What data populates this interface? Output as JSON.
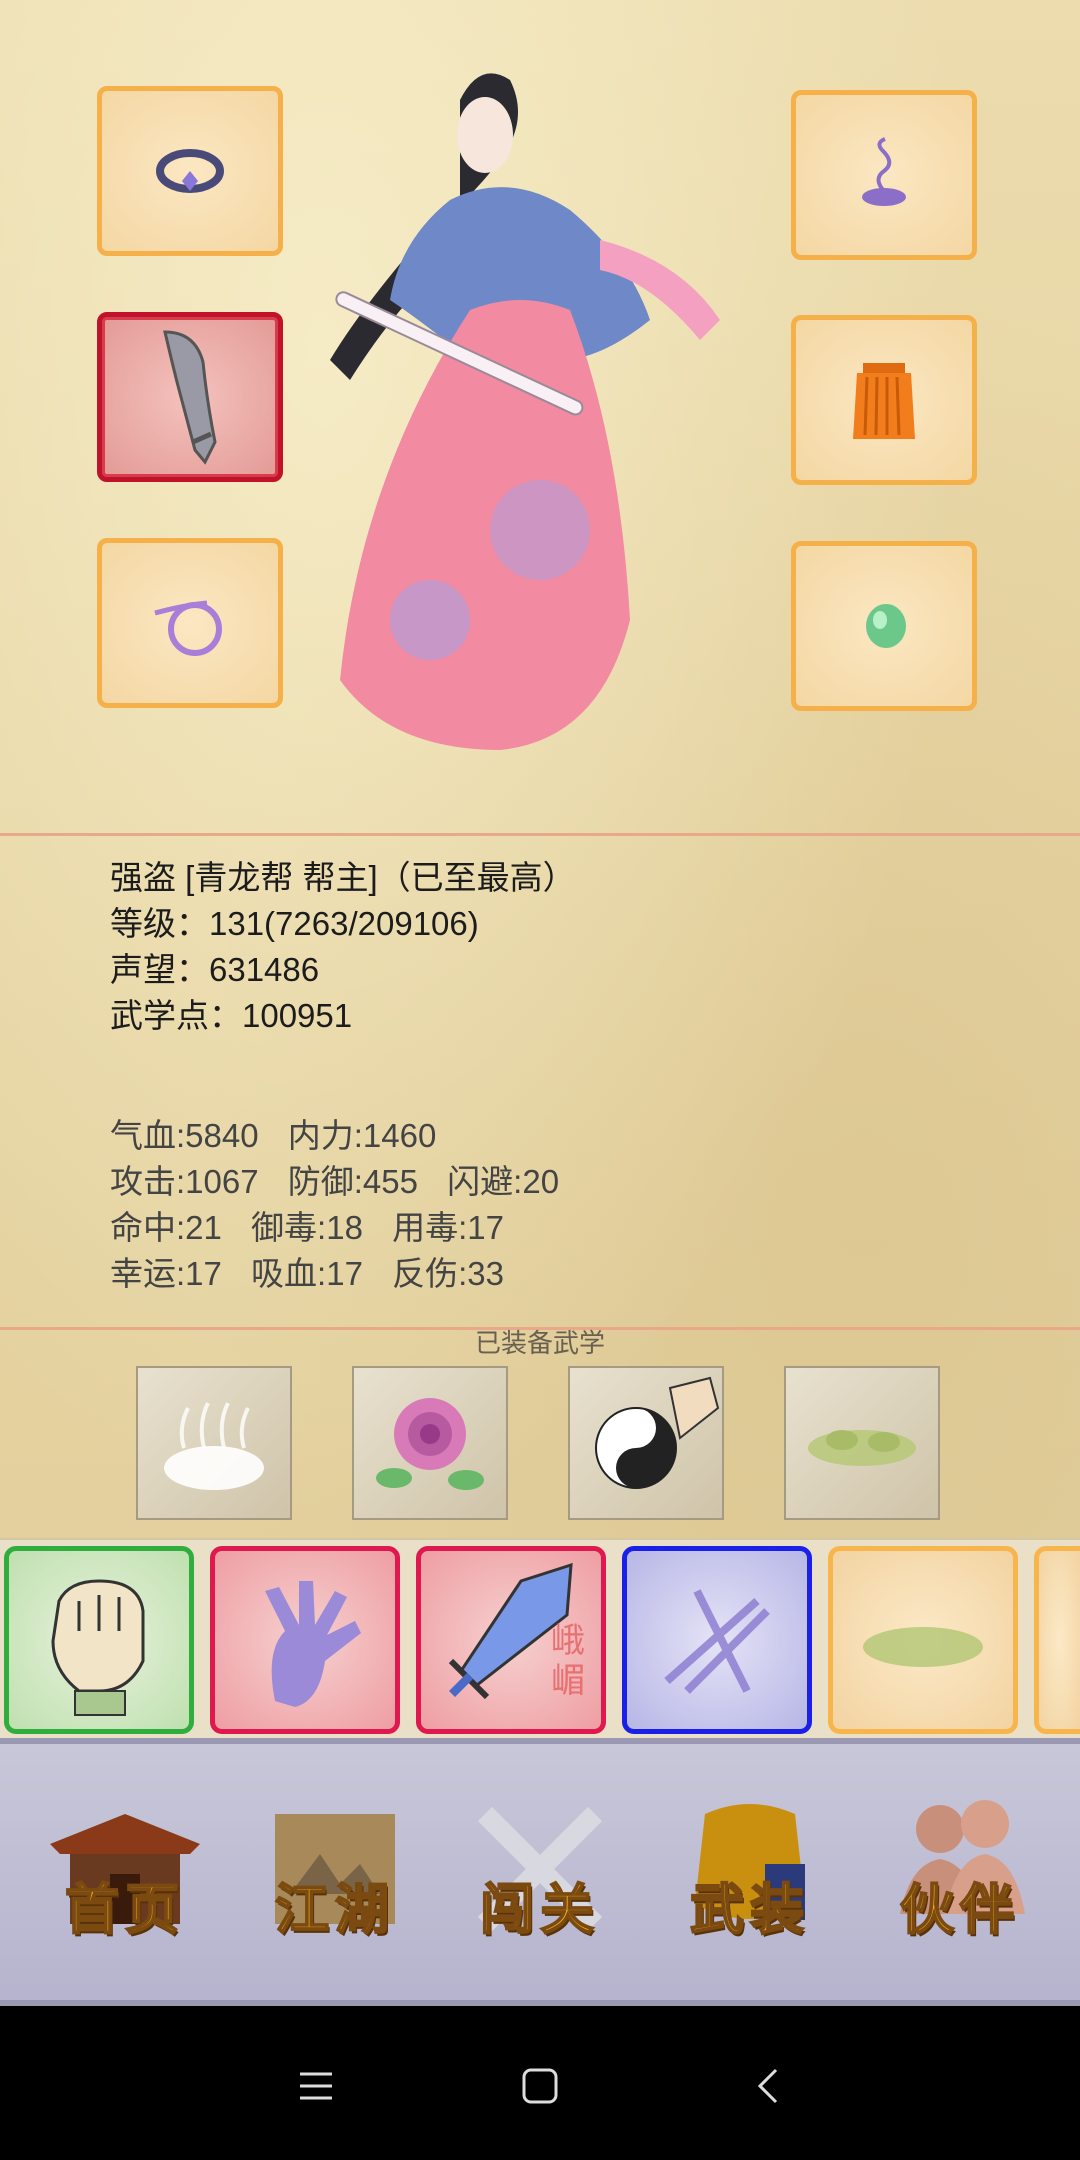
{
  "character": {
    "title_line": "强盗 [青龙帮 帮主]（已至最高）",
    "level_line": "等级：131(7263/209106)",
    "reputation_line": "声望：631486",
    "martial_points_line": "武学点：100951"
  },
  "stats": {
    "row1": [
      "气血:5840",
      "内力:1460"
    ],
    "row2": [
      "攻击:1067",
      "防御:455",
      "闪避:20"
    ],
    "row3": [
      "命中:21",
      "御毒:18",
      "用毒:17"
    ],
    "row4": [
      "幸运:17",
      "吸血:17",
      "反伤:33"
    ]
  },
  "equipped_skills_title": "已装备武学",
  "equipment_slots": [
    {
      "icon": "bracelet-icon"
    },
    {
      "icon": "saber-icon",
      "selected": true
    },
    {
      "icon": "ring-icon"
    },
    {
      "icon": "incense-icon"
    },
    {
      "icon": "skirt-armor-icon"
    },
    {
      "icon": "jade-bead-icon"
    }
  ],
  "skill_cards_text": {
    "emei_sword": "峨嵋"
  },
  "nav": {
    "home": "首页",
    "jianghu": "江湖",
    "challenge": "闯关",
    "equipment": "武装",
    "partner": "伙伴"
  },
  "colors": {
    "slot_border": "#f5b04a",
    "selected_border": "#c0122a",
    "nav_text": "#f2b020"
  }
}
